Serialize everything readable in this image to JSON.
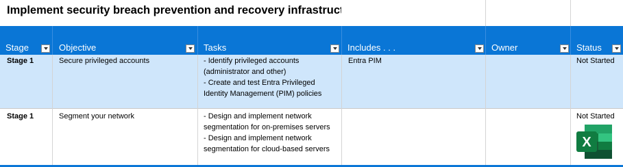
{
  "sheet": {
    "title": "Implement security breach prevention and recovery infrastructure"
  },
  "columns": [
    {
      "label": "Stage",
      "filter_icon": "sort-filter-icon"
    },
    {
      "label": "Objective",
      "filter_icon": "filter-dropdown-icon"
    },
    {
      "label": "Tasks",
      "filter_icon": "filter-dropdown-icon"
    },
    {
      "label": "Includes . . .",
      "filter_icon": "filter-dropdown-icon"
    },
    {
      "label": "Owner",
      "filter_icon": "filter-dropdown-icon"
    },
    {
      "label": "Status",
      "filter_icon": "filter-dropdown-icon"
    }
  ],
  "rows": [
    {
      "stage": "Stage 1",
      "objective": "Secure privileged accounts",
      "tasks": [
        "- Identify privileged accounts",
        "(administrator and other)",
        "- Create and test Entra Privileged",
        "Identity Management (PIM) policies"
      ],
      "includes": "Entra PIM",
      "owner": "",
      "status": "Not Started"
    },
    {
      "stage": "Stage 1",
      "objective": "Segment your network",
      "tasks": [
        "- Design and implement network",
        "segmentation for on-premises servers",
        "- Design and implement network",
        "segmentation for cloud-based servers"
      ],
      "includes": "",
      "owner": "",
      "status": "Not Started"
    }
  ],
  "colors": {
    "header_blue": "#0a76d6",
    "selected_row": "#cfe6fb",
    "excel_green": "#1e7145"
  },
  "icons": {
    "app_icon": "excel-icon"
  }
}
